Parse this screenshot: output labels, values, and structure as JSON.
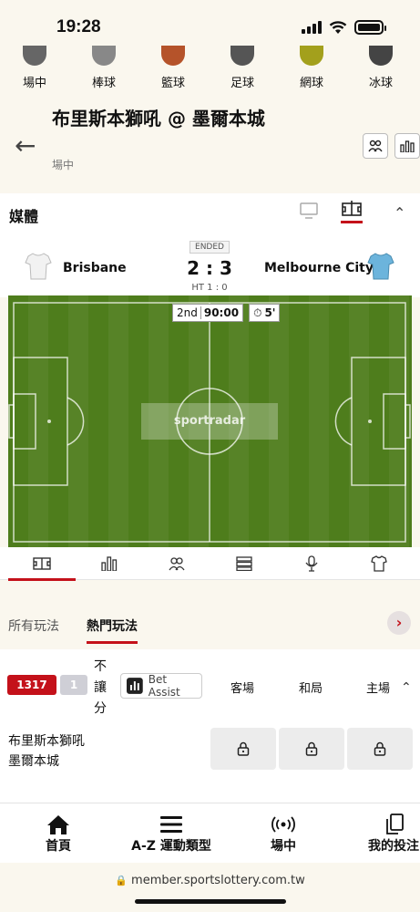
{
  "status_bar": {
    "time": "19:28"
  },
  "sports_tabs": [
    {
      "label": "場中",
      "icon": "live-icon"
    },
    {
      "label": "棒球",
      "icon": "baseball-icon"
    },
    {
      "label": "籃球",
      "icon": "basketball-icon"
    },
    {
      "label": "足球",
      "icon": "soccer-icon"
    },
    {
      "label": "網球",
      "icon": "tennis-icon"
    },
    {
      "label": "冰球",
      "icon": "hockey-icon"
    }
  ],
  "header": {
    "title": "布里斯本獅吼 @ 墨爾本城",
    "subtitle": "場中"
  },
  "media": {
    "title": "媒體"
  },
  "match": {
    "status": "ENDED",
    "home": "Brisbane",
    "away": "Melbourne City",
    "score": "2 : 3",
    "halftime": "HT 1 : 0",
    "period": "2nd",
    "clock": "90:00",
    "added_time": "5'",
    "watermark": "sportradar",
    "home_color": "#f2f2f2",
    "away_color": "#6cb4dc"
  },
  "market_tabs": [
    "所有玩法",
    "熱門玩法"
  ],
  "odds": {
    "count_badge": "1317",
    "secondary_badge": "1",
    "market_label": "不讓分",
    "bet_assist": "Bet Assist",
    "columns": [
      "客場",
      "和局",
      "主場"
    ],
    "team_rows": [
      "布里斯本獅吼",
      "墨爾本城"
    ]
  },
  "bottom_nav": [
    {
      "label": "首頁",
      "icon": "home-icon"
    },
    {
      "label": "A-Z 運動類型",
      "icon": "menu-icon"
    },
    {
      "label": "場中",
      "icon": "live-broadcast-icon"
    },
    {
      "label": "我的投注",
      "icon": "bets-icon"
    }
  ],
  "url": "member.sportslottery.com.tw",
  "colors": {
    "accent": "#c4111a",
    "background": "#faf7ee",
    "pitch": "#4e7d1c"
  }
}
